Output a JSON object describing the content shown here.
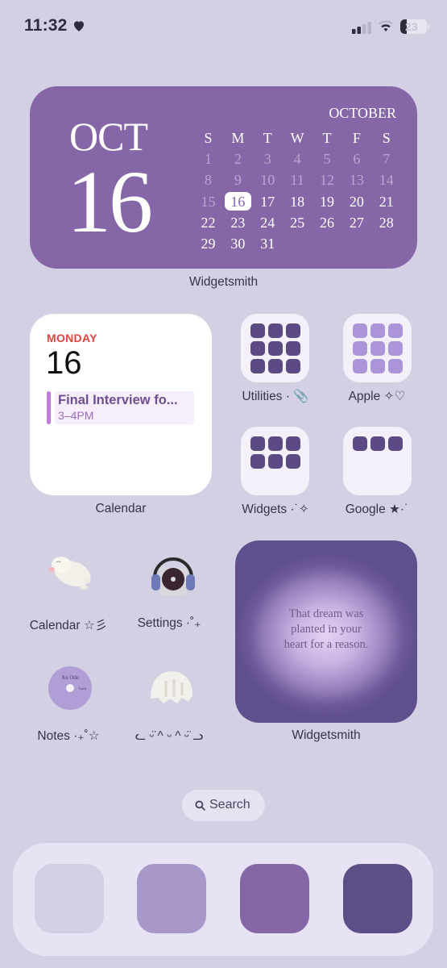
{
  "status_bar": {
    "time": "11:32",
    "focus_icon": "heart-icon",
    "signal_bars_active": 2,
    "signal_bars_total": 4,
    "wifi_icon": "wifi-icon",
    "battery_percent": "23",
    "battery_level": 0.23
  },
  "month_widget": {
    "app_label": "Widgetsmith",
    "month_abbr": "OCT",
    "day": "16",
    "month_name": "OCTOBER",
    "weekdays": [
      "S",
      "M",
      "T",
      "W",
      "T",
      "F",
      "S"
    ],
    "days": [
      "1",
      "2",
      "3",
      "4",
      "5",
      "6",
      "7",
      "8",
      "9",
      "10",
      "11",
      "12",
      "13",
      "14",
      "15",
      "16",
      "17",
      "18",
      "19",
      "20",
      "21",
      "22",
      "23",
      "24",
      "25",
      "26",
      "27",
      "28",
      "29",
      "30",
      "31"
    ],
    "today": "16",
    "colors": {
      "background": "#8566a6",
      "past_day": "#b9a5d0"
    }
  },
  "calendar_widget": {
    "app_label": "Calendar",
    "weekday": "MONDAY",
    "day": "16",
    "event_title": "Final Interview fo...",
    "event_time": "3–4PM",
    "colors": {
      "weekday": "#e0463f",
      "event_bar": "#c27bdc"
    }
  },
  "folders": [
    {
      "label": "Utilities · 📎",
      "count": 9,
      "color": "#5c4a85"
    },
    {
      "label": "Apple ✧♡",
      "count": 9,
      "color": "#ab95d8"
    },
    {
      "label": "Widgets ·˙✧",
      "count": 6,
      "color": "#5c4a85"
    },
    {
      "label": "Google ★·˙",
      "count": 3,
      "color": "#5c4a85"
    }
  ],
  "apps": [
    {
      "label": "Calendar ☆彡",
      "icon": "squishy-cat-icon"
    },
    {
      "label": "Settings ·˚₊",
      "icon": "headphones-cd-player-icon"
    },
    {
      "label": "Notes ·₊˚☆",
      "icon": "cd-disc-icon",
      "disc_title": "An Ode",
      "disc_track": "Truth"
    },
    {
      "label": "ᓚ ᵕ̈ ^ ᵕ ^ ᵕ̈ ᓗ",
      "icon": "squishy-paw-icon"
    }
  ],
  "quote_widget": {
    "app_label": "Widgetsmith",
    "quote_lines": [
      "That dream was",
      "planted in your",
      "heart for a reason."
    ]
  },
  "search": {
    "label": "Search",
    "icon": "search-icon"
  },
  "dock": {
    "apps": [
      {
        "name": "dock-app-1",
        "color": "#d4d0e3"
      },
      {
        "name": "dock-app-2",
        "color": "#a897c9"
      },
      {
        "name": "dock-app-3",
        "color": "#8566a6"
      },
      {
        "name": "dock-app-4",
        "color": "#5e4e87"
      }
    ]
  },
  "colors": {
    "wallpaper": "#d4d0e3",
    "dock": "#e7e3f5"
  }
}
